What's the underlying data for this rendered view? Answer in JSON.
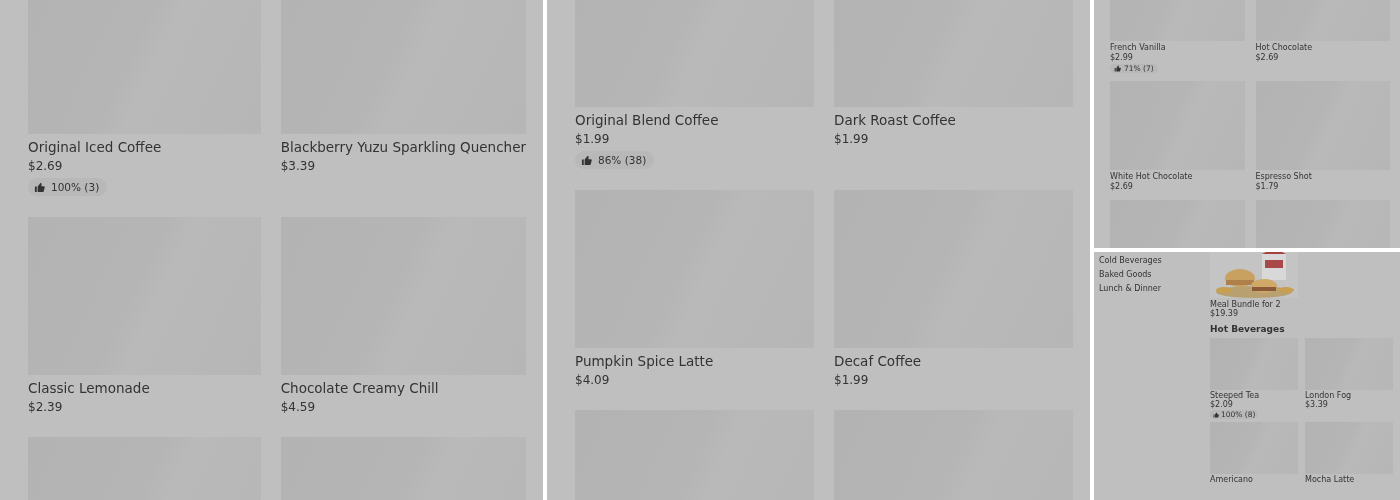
{
  "panels": [
    {
      "kind": "grid",
      "items": [
        {
          "name": "Original Iced Coffee",
          "price": "$2.69",
          "rating": "100% (3)"
        },
        {
          "name": "Blackberry Yuzu Sparkling Quencher",
          "price": "$3.39"
        },
        {
          "name": "Classic Lemonade",
          "price": "$2.39"
        },
        {
          "name": "Chocolate Creamy Chill",
          "price": "$4.59"
        }
      ],
      "more_below": true
    },
    {
      "kind": "grid",
      "items": [
        {
          "name": "Original Blend Coffee",
          "price": "$1.99",
          "rating": "86% (38)"
        },
        {
          "name": "Dark Roast Coffee",
          "price": "$1.99"
        },
        {
          "name": "Pumpkin Spice Latte",
          "price": "$4.09"
        },
        {
          "name": "Decaf Coffee",
          "price": "$1.99"
        }
      ],
      "more_below": true
    },
    {
      "kind": "compact",
      "items": [
        {
          "name": "French Vanilla",
          "price": "$2.99",
          "rating": "71% (7)"
        },
        {
          "name": "Hot Chocolate",
          "price": "$2.69"
        },
        {
          "name": "White Hot Chocolate",
          "price": "$2.69"
        },
        {
          "name": "Espresso Shot",
          "price": "$1.79"
        }
      ],
      "more_below": true
    },
    {
      "kind": "sidebar",
      "sidebar": {
        "items": [
          "Cold Beverages",
          "Baked Goods",
          "Lunch & Dinner"
        ]
      },
      "featured": {
        "kind": "picture",
        "name": "Meal Bundle for 2",
        "price": "$19.39"
      },
      "section_title": "Hot Beverages",
      "items": [
        {
          "name": "Steeped Tea",
          "price": "$2.09",
          "rating": "100% (8)"
        },
        {
          "name": "London Fog",
          "price": "$3.39"
        },
        {
          "name": "Americano"
        },
        {
          "name": "Mocha Latte"
        }
      ]
    }
  ]
}
